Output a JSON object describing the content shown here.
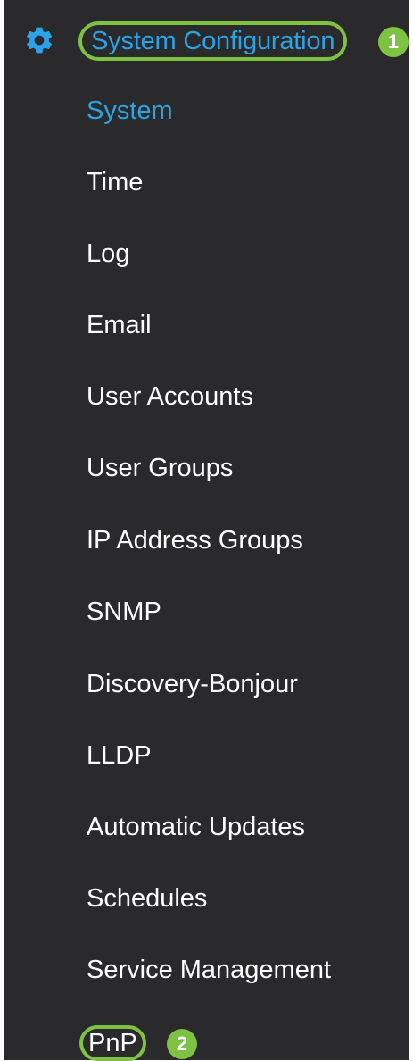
{
  "sidebar": {
    "section_title": "System Configuration",
    "section_icon": "gear-icon",
    "accent_color": "#2ba3e6",
    "highlight_color": "#7dc243",
    "callouts": [
      "1",
      "2"
    ],
    "items": [
      {
        "label": "System",
        "active": true
      },
      {
        "label": "Time",
        "active": false
      },
      {
        "label": "Log",
        "active": false
      },
      {
        "label": "Email",
        "active": false
      },
      {
        "label": "User Accounts",
        "active": false
      },
      {
        "label": "User Groups",
        "active": false
      },
      {
        "label": "IP Address Groups",
        "active": false
      },
      {
        "label": "SNMP",
        "active": false
      },
      {
        "label": "Discovery-Bonjour",
        "active": false
      },
      {
        "label": "LLDP",
        "active": false
      },
      {
        "label": "Automatic Updates",
        "active": false
      },
      {
        "label": "Schedules",
        "active": false
      },
      {
        "label": "Service Management",
        "active": false
      },
      {
        "label": "PnP",
        "active": false
      }
    ]
  }
}
